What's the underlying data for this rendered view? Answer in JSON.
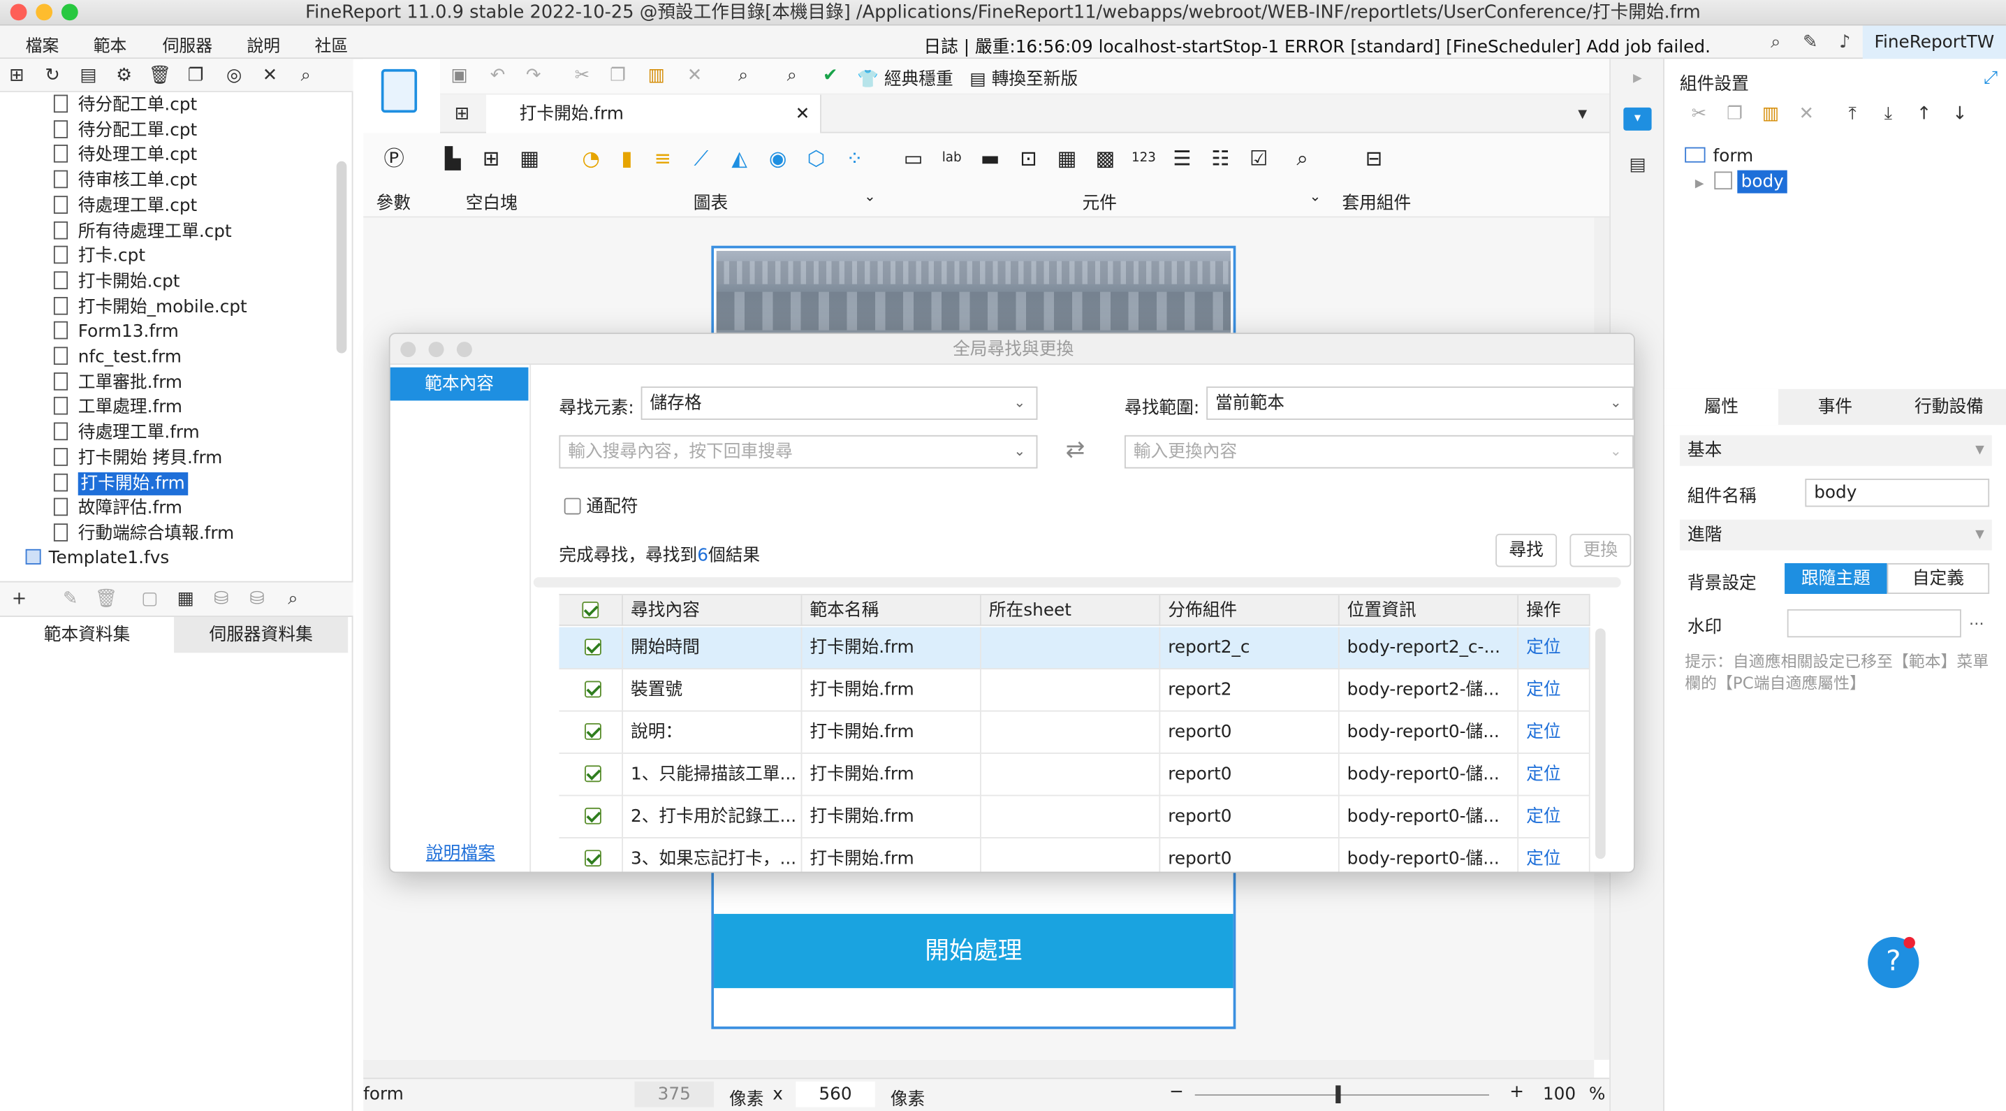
{
  "window": {
    "title": "FineReport 11.0.9 stable 2022-10-25 @預設工作目錄[本機目錄]   /Applications/FineReport11/webapps/webroot/WEB-INF/reportlets/UserConference/打卡開始.frm"
  },
  "menubar": {
    "items": [
      "檔案",
      "範本",
      "伺服器",
      "說明",
      "社區"
    ],
    "log": "日誌 | 嚴重:16:56:09 localhost-startStop-1 ERROR [standard] [FineScheduler] Add job failed.",
    "brand": "FineReportTW"
  },
  "file_tree": {
    "items": [
      {
        "label": "待分配工单.cpt"
      },
      {
        "label": "待分配工單.cpt"
      },
      {
        "label": "待处理工单.cpt"
      },
      {
        "label": "待审核工单.cpt"
      },
      {
        "label": "待處理工單.cpt"
      },
      {
        "label": "所有待處理工單.cpt"
      },
      {
        "label": "打卡.cpt"
      },
      {
        "label": "打卡開始.cpt"
      },
      {
        "label": "打卡開始_mobile.cpt"
      },
      {
        "label": "Form13.frm"
      },
      {
        "label": "nfc_test.frm"
      },
      {
        "label": "工單審批.frm"
      },
      {
        "label": "工單處理.frm"
      },
      {
        "label": "待處理工單.frm"
      },
      {
        "label": "打卡開始 拷貝.frm"
      },
      {
        "label": "打卡開始.frm",
        "selected": true
      },
      {
        "label": "故障評估.frm"
      },
      {
        "label": "行動端綜合填報.frm"
      }
    ],
    "bottom_item": "Template1.fvs"
  },
  "datasets": {
    "tabs": [
      "範本資料集",
      "伺服器資料集"
    ]
  },
  "toolbar": {
    "classic_label": "經典穩重",
    "convert_label": "轉換至新版"
  },
  "document_tab": {
    "title": "打卡開始.frm"
  },
  "widget_groups": {
    "param": "參數",
    "blank": "空白塊",
    "chart": "圖表",
    "component": "元件",
    "apply": "套用組件"
  },
  "canvas": {
    "button_label": "開始處理"
  },
  "status": {
    "mode": "form",
    "width": "375",
    "unit1": "像素",
    "x": "x",
    "height": "560",
    "unit2": "像素",
    "zoom": "100",
    "percent": "%"
  },
  "right_panel": {
    "title": "組件設置",
    "tree_root": "form",
    "tree_child": "body",
    "prop_tabs": [
      "屬性",
      "事件",
      "行動設備"
    ],
    "section_basic": "基本",
    "name_label": "組件名稱",
    "name_value": "body",
    "section_advanced": "進階",
    "bg_label": "背景設定",
    "bg_option_follow": "跟隨主題",
    "bg_option_custom": "自定義",
    "watermark_label": "水印",
    "hint": "提示：自適應相關設定已移至【範本】菜單欄的【PC端自適應屬性】"
  },
  "dialog": {
    "title": "全局尋找與更換",
    "side_item": "範本內容",
    "side_link": "說明檔案",
    "find_element_label": "尋找元素:",
    "find_element_value": "儲存格",
    "find_scope_label": "尋找範圍:",
    "find_scope_value": "當前範本",
    "search_placeholder": "輸入搜尋內容，按下回車搜尋",
    "replace_placeholder": "輸入更換內容",
    "wildcard_label": "通配符",
    "result_prefix": "完成尋找，尋找到",
    "result_count": "6",
    "result_suffix": "個結果",
    "find_button": "尋找",
    "replace_button": "更換",
    "columns": [
      "尋找內容",
      "範本名稱",
      "所在sheet",
      "分佈組件",
      "位置資訊",
      "操作"
    ],
    "rows": [
      {
        "content": "開始時間",
        "template": "打卡開始.frm",
        "sheet": "",
        "widget": "report2_c",
        "position": "body-report2_c-...",
        "action": "定位"
      },
      {
        "content": "裝置號",
        "template": "打卡開始.frm",
        "sheet": "",
        "widget": "report2",
        "position": "body-report2-儲...",
        "action": "定位"
      },
      {
        "content": "說明：",
        "template": "打卡開始.frm",
        "sheet": "",
        "widget": "report0",
        "position": "body-report0-儲...",
        "action": "定位"
      },
      {
        "content": "1、只能掃描該工單...",
        "template": "打卡開始.frm",
        "sheet": "",
        "widget": "report0",
        "position": "body-report0-儲...",
        "action": "定位"
      },
      {
        "content": "2、打卡用於記錄工...",
        "template": "打卡開始.frm",
        "sheet": "",
        "widget": "report0",
        "position": "body-report0-儲...",
        "action": "定位"
      },
      {
        "content": "3、如果忘記打卡，...",
        "template": "打卡開始.frm",
        "sheet": "",
        "widget": "report0",
        "position": "body-report0-儲...",
        "action": "定位"
      }
    ]
  },
  "colors": {
    "accent": "#1e8fe1",
    "selection": "#1e6fd9",
    "start_button": "#1aa3e0",
    "row_selected": "#dceefc"
  }
}
